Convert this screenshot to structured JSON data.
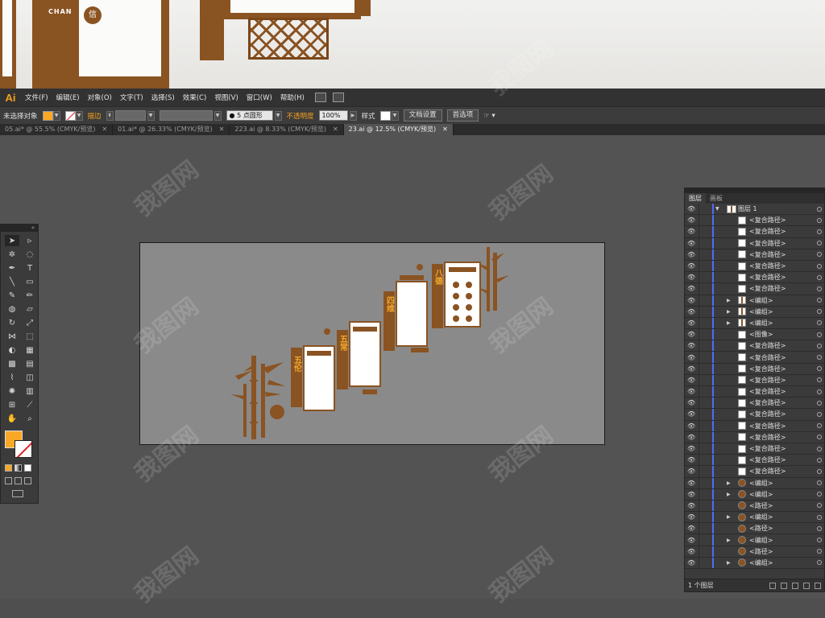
{
  "photo": {
    "vertical_text_1": "CHANG",
    "vertical_text_2": "信"
  },
  "menubar": {
    "logo": "Ai",
    "items": [
      "文件(F)",
      "编辑(E)",
      "对象(O)",
      "文字(T)",
      "选择(S)",
      "效果(C)",
      "视图(V)",
      "窗口(W)",
      "帮助(H)"
    ]
  },
  "controlbar": {
    "selection_status": "未选择对象",
    "stroke_label": "描边",
    "brush_value": "5 点圆形",
    "opacity_label": "不透明度",
    "opacity_value": "100%",
    "style_label": "样式",
    "doc_setup_button": "文档设置",
    "preferences_button": "首选项",
    "fill_color": "#f9a825"
  },
  "tabs": [
    {
      "label": "05.ai* @ 55.5% (CMYK/预览)",
      "active": false
    },
    {
      "label": "01.ai* @ 26.33% (CMYK/预览)",
      "active": false
    },
    {
      "label": "223.ai @ 8.33% (CMYK/预览)",
      "active": false
    },
    {
      "label": "23.ai @ 12.5% (CMYK/预览)",
      "active": true
    }
  ],
  "artwork": {
    "panel_titles": [
      "五伦",
      "五常",
      "四维",
      "八德"
    ],
    "brand_color": "#8a5322",
    "accent_color": "#f0a82a"
  },
  "layers_panel": {
    "tab_layers": "图层",
    "tab_artboards": "画板",
    "top_layer": "图层 1",
    "rows": [
      {
        "label": "<复合路径>",
        "thumb": "white",
        "expand": false
      },
      {
        "label": "<复合路径>",
        "thumb": "white",
        "expand": false
      },
      {
        "label": "<复合路径>",
        "thumb": "white",
        "expand": false
      },
      {
        "label": "<复合路径>",
        "thumb": "white",
        "expand": false
      },
      {
        "label": "<复合路径>",
        "thumb": "white",
        "expand": false
      },
      {
        "label": "<复合路径>",
        "thumb": "white",
        "expand": false
      },
      {
        "label": "<复合路径>",
        "thumb": "white",
        "expand": false
      },
      {
        "label": "<编组>",
        "thumb": "img",
        "expand": true
      },
      {
        "label": "<编组>",
        "thumb": "img",
        "expand": true
      },
      {
        "label": "<编组>",
        "thumb": "img",
        "expand": true
      },
      {
        "label": "<图像>",
        "thumb": "white",
        "expand": false
      },
      {
        "label": "<复合路径>",
        "thumb": "white",
        "expand": false
      },
      {
        "label": "<复合路径>",
        "thumb": "white",
        "expand": false
      },
      {
        "label": "<复合路径>",
        "thumb": "white",
        "expand": false
      },
      {
        "label": "<复合路径>",
        "thumb": "white",
        "expand": false
      },
      {
        "label": "<复合路径>",
        "thumb": "white",
        "expand": false
      },
      {
        "label": "<复合路径>",
        "thumb": "white",
        "expand": false
      },
      {
        "label": "<复合路径>",
        "thumb": "white",
        "expand": false
      },
      {
        "label": "<复合路径>",
        "thumb": "white",
        "expand": false
      },
      {
        "label": "<复合路径>",
        "thumb": "white",
        "expand": false
      },
      {
        "label": "<复合路径>",
        "thumb": "white",
        "expand": false
      },
      {
        "label": "<复合路径>",
        "thumb": "white",
        "expand": false
      },
      {
        "label": "<复合路径>",
        "thumb": "white",
        "expand": false
      },
      {
        "label": "<编组>",
        "thumb": "brown",
        "expand": true
      },
      {
        "label": "<编组>",
        "thumb": "brown",
        "expand": true
      },
      {
        "label": "<路径>",
        "thumb": "brown",
        "expand": false
      },
      {
        "label": "<编组>",
        "thumb": "brown",
        "expand": true
      },
      {
        "label": "<路径>",
        "thumb": "brown",
        "expand": false
      },
      {
        "label": "<编组>",
        "thumb": "brown",
        "expand": true
      },
      {
        "label": "<路径>",
        "thumb": "brown",
        "expand": false
      },
      {
        "label": "<编组>",
        "thumb": "brown",
        "expand": true
      }
    ],
    "footer_text": "1 个图层"
  },
  "watermark": "我图网"
}
